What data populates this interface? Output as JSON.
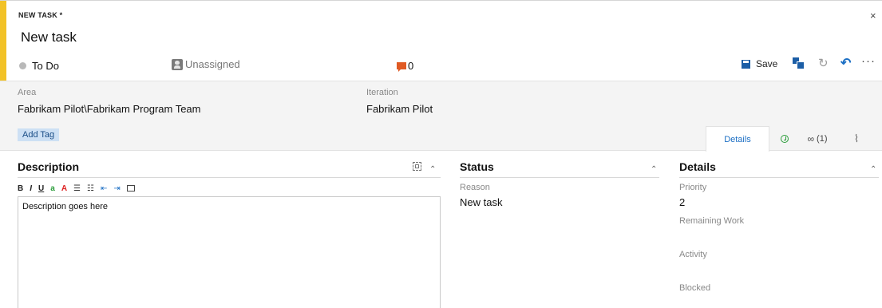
{
  "header": {
    "type_label": "NEW TASK *",
    "close_label": "×",
    "title": "New task",
    "state": "To Do",
    "assignee": "Unassigned",
    "comment_count": "0"
  },
  "toolbar": {
    "save_label": "Save",
    "refresh_glyph": "↻",
    "undo_glyph": "↶",
    "more_glyph": "···"
  },
  "meta": {
    "area_label": "Area",
    "area_value": "Fabrikam Pilot\\Fabrikam Program Team",
    "iteration_label": "Iteration",
    "iteration_value": "Fabrikam Pilot",
    "add_tag_label": "Add Tag"
  },
  "tabs": {
    "details_label": "Details",
    "links_label": "(1)",
    "link_glyph": "∞",
    "clip_glyph": "⌇"
  },
  "description": {
    "title": "Description",
    "text": "Description goes here",
    "toolbar": {
      "bold": "B",
      "italic": "I",
      "underline": "U",
      "highlight": "a",
      "font_color": "A",
      "bullets": "☰",
      "numbers": "☷",
      "outdent": "⇤",
      "indent": "⇥"
    }
  },
  "status": {
    "title": "Status",
    "reason_label": "Reason",
    "reason_value": "New task"
  },
  "details": {
    "title": "Details",
    "priority_label": "Priority",
    "priority_value": "2",
    "remaining_work_label": "Remaining Work",
    "activity_label": "Activity",
    "blocked_label": "Blocked"
  },
  "icons": {
    "state": "gray-dot-icon",
    "assignee": "user-icon",
    "comments": "comment-icon",
    "save": "save-icon",
    "copy": "copy-icon",
    "refresh": "refresh-icon",
    "undo": "undo-icon",
    "more": "more-icon",
    "history": "history-icon",
    "links": "link-icon",
    "attachments": "attachment-icon",
    "maximize": "maximize-icon",
    "chevron": "chevron-up-icon"
  },
  "colors": {
    "accent": "#f2c227",
    "primary": "#1c5ea6",
    "tag_bg": "#cde0f4",
    "comment": "#e05a24",
    "history": "#2a9d3a"
  }
}
